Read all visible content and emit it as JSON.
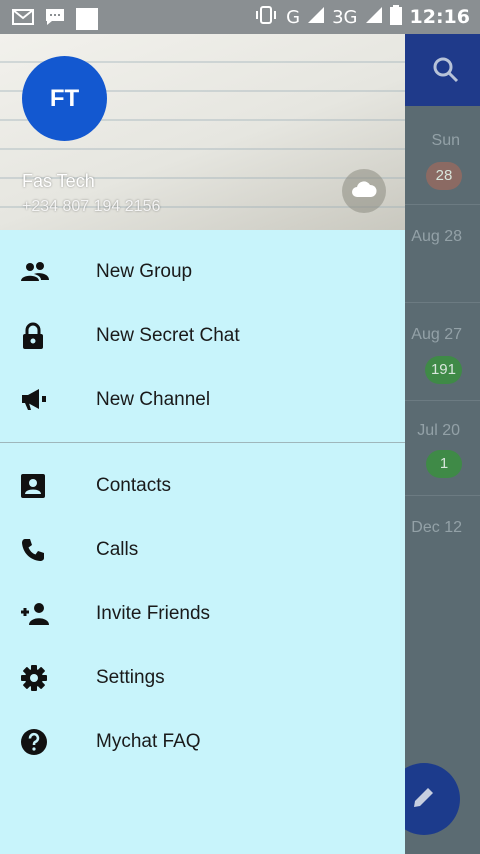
{
  "status_bar": {
    "time": "12:16",
    "network": "G",
    "network2": "3G",
    "icons": [
      "gmail-icon",
      "sms-icon",
      "notification-icon",
      "vibrate-icon",
      "signal-icon",
      "battery-icon"
    ]
  },
  "background_chats": {
    "rows": [
      {
        "date": "Sun",
        "badge": "28",
        "badge_color": "#8b6a63"
      },
      {
        "date": "Aug 28",
        "badge": ""
      },
      {
        "date": "Aug 27",
        "badge": "191",
        "badge_color": "#3f8a47"
      },
      {
        "date": "Jul 20",
        "badge": "1",
        "badge_color": "#3f8a47"
      },
      {
        "date": "Dec 12",
        "badge": ""
      }
    ]
  },
  "drawer": {
    "avatar_initials": "FT",
    "user_name": "Fas Tech",
    "user_phone": "+234 807 194 2156",
    "colors": {
      "accent": "#1358d0",
      "drawer_bg": "#c8f4fb",
      "appbar": "#1f3a8a"
    },
    "menu_group1": [
      {
        "label": "New Group",
        "icon": "group-icon"
      },
      {
        "label": "New Secret Chat",
        "icon": "lock-icon"
      },
      {
        "label": "New Channel",
        "icon": "megaphone-icon"
      }
    ],
    "menu_group2": [
      {
        "label": "Contacts",
        "icon": "contacts-icon"
      },
      {
        "label": "Calls",
        "icon": "phone-icon"
      },
      {
        "label": "Invite Friends",
        "icon": "add-person-icon"
      },
      {
        "label": "Settings",
        "icon": "gear-icon"
      },
      {
        "label": "Mychat FAQ",
        "icon": "help-icon"
      }
    ]
  }
}
